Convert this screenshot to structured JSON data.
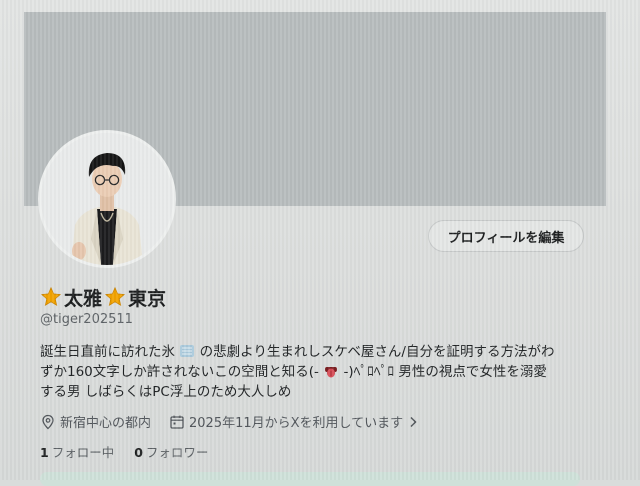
{
  "profile": {
    "edit_button": "プロフィールを編集",
    "name_part1": "太雅",
    "name_part2": "東京",
    "handle": "@tiger202511",
    "bio_line1_a": "誕生日直前に訪れた氷",
    "bio_line1_b": "の悲劇より生まれしスケベ屋さん/自分を証明する方法がわ",
    "bio_line2_a": "ずか160文字しか許されないこの空間と知る(-",
    "bio_line2_b": "-)ﾍﾟﾛﾍﾟﾛ 男性の視点で女性を溺愛",
    "bio_line3": "する男 しばらくはPC浮上のため大人しめ",
    "location": "新宿中心の都内",
    "joined": "2025年11月からXを利用しています",
    "following_count": "1",
    "following_label": "フォロー中",
    "followers_count": "0",
    "followers_label": "フォロワー"
  },
  "icons": [
    "star-icon",
    "ice-emoji-icon",
    "tongue-emoji-icon",
    "location-pin-icon",
    "calendar-icon",
    "chevron-right-icon"
  ],
  "colors": {
    "star": "#f2a300",
    "banner": "#b7bcbd",
    "bottom_bar": "#cfe1d9"
  }
}
